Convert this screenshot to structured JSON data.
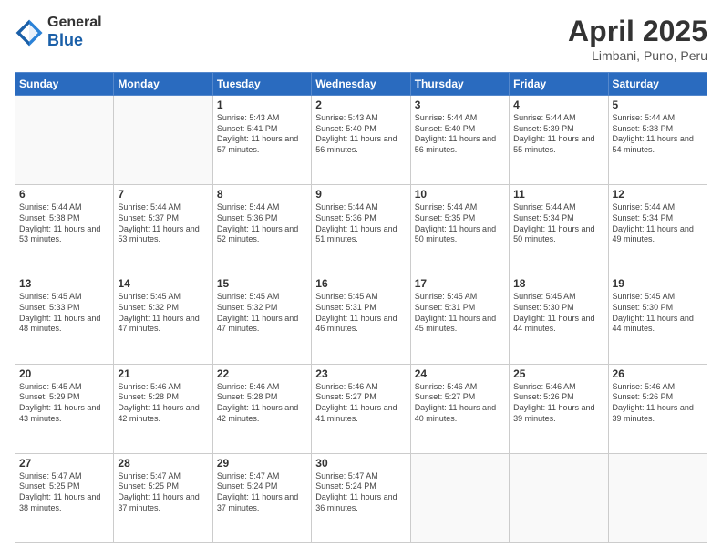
{
  "header": {
    "logo_general": "General",
    "logo_blue": "Blue",
    "title": "April 2025",
    "location": "Limbani, Puno, Peru"
  },
  "columns": [
    "Sunday",
    "Monday",
    "Tuesday",
    "Wednesday",
    "Thursday",
    "Friday",
    "Saturday"
  ],
  "weeks": [
    [
      {
        "day": "",
        "content": ""
      },
      {
        "day": "",
        "content": ""
      },
      {
        "day": "1",
        "content": "Sunrise: 5:43 AM\nSunset: 5:41 PM\nDaylight: 11 hours and 57 minutes."
      },
      {
        "day": "2",
        "content": "Sunrise: 5:43 AM\nSunset: 5:40 PM\nDaylight: 11 hours and 56 minutes."
      },
      {
        "day": "3",
        "content": "Sunrise: 5:44 AM\nSunset: 5:40 PM\nDaylight: 11 hours and 56 minutes."
      },
      {
        "day": "4",
        "content": "Sunrise: 5:44 AM\nSunset: 5:39 PM\nDaylight: 11 hours and 55 minutes."
      },
      {
        "day": "5",
        "content": "Sunrise: 5:44 AM\nSunset: 5:38 PM\nDaylight: 11 hours and 54 minutes."
      }
    ],
    [
      {
        "day": "6",
        "content": "Sunrise: 5:44 AM\nSunset: 5:38 PM\nDaylight: 11 hours and 53 minutes."
      },
      {
        "day": "7",
        "content": "Sunrise: 5:44 AM\nSunset: 5:37 PM\nDaylight: 11 hours and 53 minutes."
      },
      {
        "day": "8",
        "content": "Sunrise: 5:44 AM\nSunset: 5:36 PM\nDaylight: 11 hours and 52 minutes."
      },
      {
        "day": "9",
        "content": "Sunrise: 5:44 AM\nSunset: 5:36 PM\nDaylight: 11 hours and 51 minutes."
      },
      {
        "day": "10",
        "content": "Sunrise: 5:44 AM\nSunset: 5:35 PM\nDaylight: 11 hours and 50 minutes."
      },
      {
        "day": "11",
        "content": "Sunrise: 5:44 AM\nSunset: 5:34 PM\nDaylight: 11 hours and 50 minutes."
      },
      {
        "day": "12",
        "content": "Sunrise: 5:44 AM\nSunset: 5:34 PM\nDaylight: 11 hours and 49 minutes."
      }
    ],
    [
      {
        "day": "13",
        "content": "Sunrise: 5:45 AM\nSunset: 5:33 PM\nDaylight: 11 hours and 48 minutes."
      },
      {
        "day": "14",
        "content": "Sunrise: 5:45 AM\nSunset: 5:32 PM\nDaylight: 11 hours and 47 minutes."
      },
      {
        "day": "15",
        "content": "Sunrise: 5:45 AM\nSunset: 5:32 PM\nDaylight: 11 hours and 47 minutes."
      },
      {
        "day": "16",
        "content": "Sunrise: 5:45 AM\nSunset: 5:31 PM\nDaylight: 11 hours and 46 minutes."
      },
      {
        "day": "17",
        "content": "Sunrise: 5:45 AM\nSunset: 5:31 PM\nDaylight: 11 hours and 45 minutes."
      },
      {
        "day": "18",
        "content": "Sunrise: 5:45 AM\nSunset: 5:30 PM\nDaylight: 11 hours and 44 minutes."
      },
      {
        "day": "19",
        "content": "Sunrise: 5:45 AM\nSunset: 5:30 PM\nDaylight: 11 hours and 44 minutes."
      }
    ],
    [
      {
        "day": "20",
        "content": "Sunrise: 5:45 AM\nSunset: 5:29 PM\nDaylight: 11 hours and 43 minutes."
      },
      {
        "day": "21",
        "content": "Sunrise: 5:46 AM\nSunset: 5:28 PM\nDaylight: 11 hours and 42 minutes."
      },
      {
        "day": "22",
        "content": "Sunrise: 5:46 AM\nSunset: 5:28 PM\nDaylight: 11 hours and 42 minutes."
      },
      {
        "day": "23",
        "content": "Sunrise: 5:46 AM\nSunset: 5:27 PM\nDaylight: 11 hours and 41 minutes."
      },
      {
        "day": "24",
        "content": "Sunrise: 5:46 AM\nSunset: 5:27 PM\nDaylight: 11 hours and 40 minutes."
      },
      {
        "day": "25",
        "content": "Sunrise: 5:46 AM\nSunset: 5:26 PM\nDaylight: 11 hours and 39 minutes."
      },
      {
        "day": "26",
        "content": "Sunrise: 5:46 AM\nSunset: 5:26 PM\nDaylight: 11 hours and 39 minutes."
      }
    ],
    [
      {
        "day": "27",
        "content": "Sunrise: 5:47 AM\nSunset: 5:25 PM\nDaylight: 11 hours and 38 minutes."
      },
      {
        "day": "28",
        "content": "Sunrise: 5:47 AM\nSunset: 5:25 PM\nDaylight: 11 hours and 37 minutes."
      },
      {
        "day": "29",
        "content": "Sunrise: 5:47 AM\nSunset: 5:24 PM\nDaylight: 11 hours and 37 minutes."
      },
      {
        "day": "30",
        "content": "Sunrise: 5:47 AM\nSunset: 5:24 PM\nDaylight: 11 hours and 36 minutes."
      },
      {
        "day": "",
        "content": ""
      },
      {
        "day": "",
        "content": ""
      },
      {
        "day": "",
        "content": ""
      }
    ]
  ]
}
